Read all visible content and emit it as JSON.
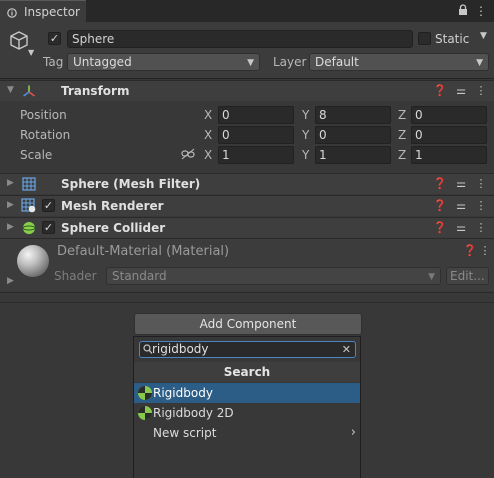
{
  "tab": {
    "label": "Inspector"
  },
  "object": {
    "name": "Sphere",
    "active": true,
    "static_label": "Static",
    "tag_label": "Tag",
    "tag_value": "Untagged",
    "layer_label": "Layer",
    "layer_value": "Default"
  },
  "transform": {
    "title": "Transform",
    "rows": [
      {
        "label": "Position",
        "x": "0",
        "y": "8",
        "z": "0"
      },
      {
        "label": "Rotation",
        "x": "0",
        "y": "0",
        "z": "0"
      },
      {
        "label": "Scale",
        "x": "1",
        "y": "1",
        "z": "1"
      }
    ],
    "axis": {
      "x": "X",
      "y": "Y",
      "z": "Z"
    }
  },
  "components": {
    "mesh_filter": "Sphere (Mesh Filter)",
    "mesh_renderer": "Mesh Renderer",
    "sphere_collider": "Sphere Collider"
  },
  "material": {
    "title": "Default-Material (Material)",
    "shader_label": "Shader",
    "shader_value": "Standard",
    "edit_label": "Edit..."
  },
  "add_component": {
    "button_label": "Add Component",
    "search_value": "rigidbody",
    "header": "Search",
    "items": [
      {
        "label": "Rigidbody",
        "selected": true
      },
      {
        "label": "Rigidbody 2D",
        "selected": false
      },
      {
        "label": "New script",
        "selected": false
      }
    ]
  },
  "colors": {
    "selection": "#2c5d87",
    "search_focus": "#4b86c2",
    "background": "#383838"
  }
}
